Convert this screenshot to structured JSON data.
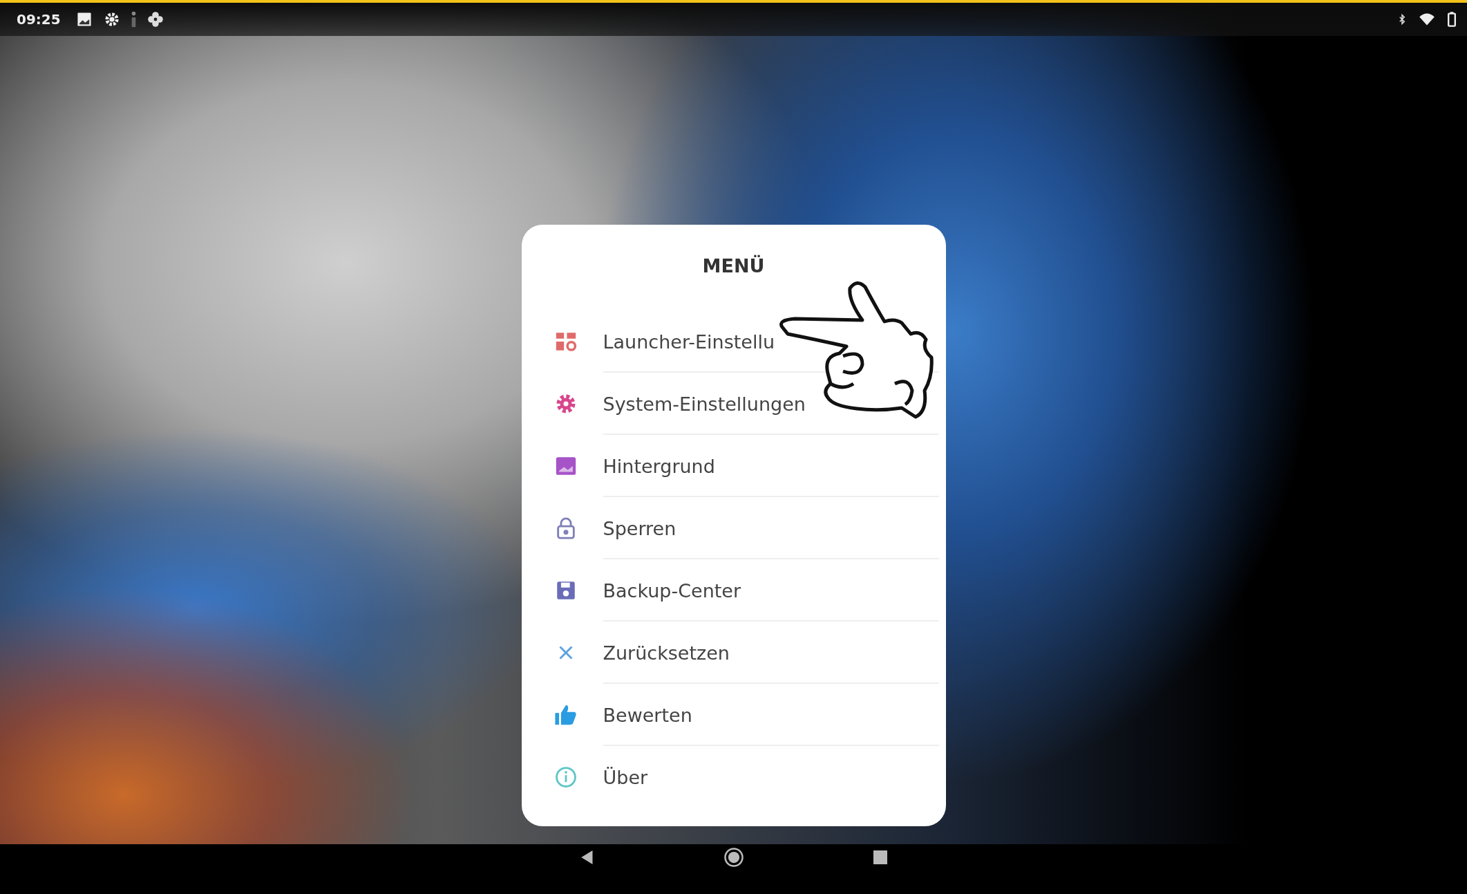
{
  "status_bar": {
    "time": "09:25"
  },
  "menu": {
    "title": "MENÜ",
    "items": [
      {
        "label": "Launcher-Einstellu",
        "kind": "launcher",
        "color": "#e06a6a"
      },
      {
        "label": "System-Einstellungen",
        "kind": "gear",
        "color": "#d8468c"
      },
      {
        "label": "Hintergrund",
        "kind": "wallpaper",
        "color": "#a653c8"
      },
      {
        "label": "Sperren",
        "kind": "lock",
        "color": "#8080b8"
      },
      {
        "label": "Backup-Center",
        "kind": "save",
        "color": "#6a6cb8"
      },
      {
        "label": "Zurücksetzen",
        "kind": "close",
        "color": "#5aa2e0"
      },
      {
        "label": "Bewerten",
        "kind": "thumb",
        "color": "#2a9ce2"
      },
      {
        "label": "Über",
        "kind": "info",
        "color": "#5ec6c8"
      }
    ]
  }
}
